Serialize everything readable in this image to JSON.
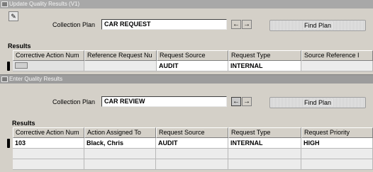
{
  "window_a": {
    "title": "Update Quality Results (V1)",
    "collection_plan_label": "Collection Plan",
    "collection_plan_value": "CAR REQUEST",
    "find_plan_label": "Find Plan",
    "results_label": "Results",
    "columns": [
      "Corrective Action Num",
      "Reference Request Nu",
      "Request Source",
      "Request Type",
      "Source Reference I"
    ],
    "rows": [
      [
        "",
        "",
        "AUDIT",
        "INTERNAL",
        ""
      ]
    ]
  },
  "window_b": {
    "title": "Enter Quality Results",
    "collection_plan_label": "Collection Plan",
    "collection_plan_value": "CAR REVIEW",
    "find_plan_label": "Find Plan",
    "results_label": "Results",
    "columns": [
      "Corrective Action Num",
      "Action Assigned To",
      "Request Source",
      "Request Type",
      "Request Priority"
    ],
    "rows": [
      [
        "103",
        "Black, Chris",
        "AUDIT",
        "INTERNAL",
        "HIGH"
      ],
      [
        "",
        "",
        "",
        "",
        ""
      ],
      [
        "",
        "",
        "",
        "",
        ""
      ]
    ]
  },
  "icons": {
    "title_icon": "window-icon",
    "toolbar_icon": "edit-icon",
    "prev_arrow": "left-arrow-icon",
    "next_arrow": "right-arrow-icon"
  }
}
